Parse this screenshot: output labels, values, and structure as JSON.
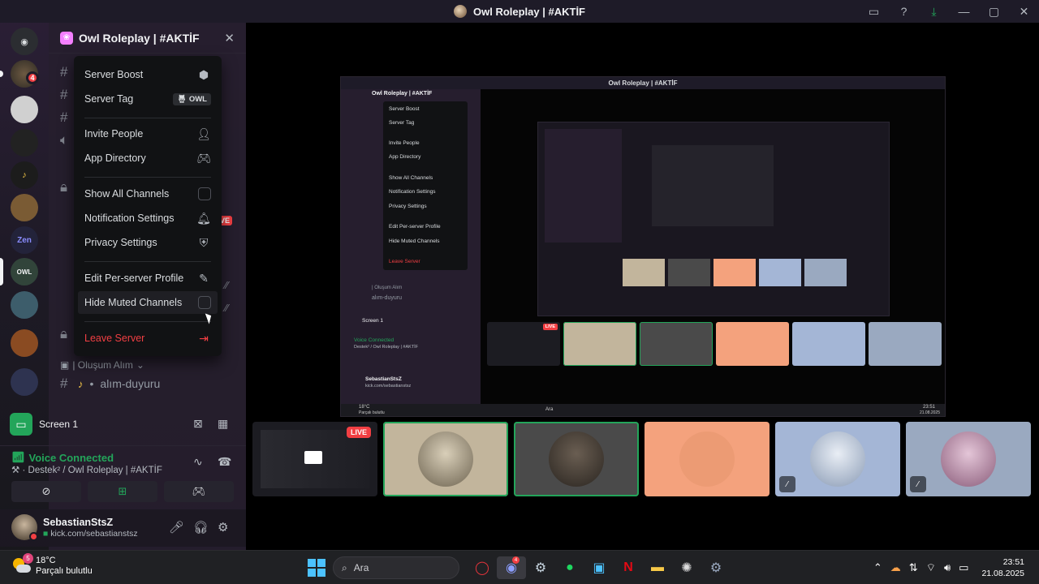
{
  "window": {
    "title": "Owl Roleplay | #AKTİF"
  },
  "server": {
    "name": "Owl Roleplay | #AKTİF"
  },
  "rail": {
    "home_badge": "4"
  },
  "channels": {
    "category": "| Oluşum Alım",
    "channel_name": "alım-duyuru",
    "live_badge": "VE"
  },
  "menu": {
    "items": [
      {
        "label": "Server Boost",
        "icon": "boost-icon"
      },
      {
        "label": "Server Tag",
        "icon": "tag-pill",
        "tag": "OWL"
      },
      {
        "label": "Invite People",
        "icon": "add-user-icon"
      },
      {
        "label": "App Directory",
        "icon": "controller-icon"
      },
      {
        "label": "Show All Channels",
        "icon": "checkbox"
      },
      {
        "label": "Notification Settings",
        "icon": "bell-icon"
      },
      {
        "label": "Privacy Settings",
        "icon": "shield-icon"
      },
      {
        "label": "Edit Per-server Profile",
        "icon": "pencil-icon"
      },
      {
        "label": "Hide Muted Channels",
        "icon": "checkbox"
      },
      {
        "label": "Leave Server",
        "icon": "leave-icon"
      }
    ]
  },
  "stream": {
    "label": "Screen 1"
  },
  "voice": {
    "status": "Voice Connected",
    "location": "Destek² / Owl Roleplay | #AKTİF"
  },
  "user": {
    "name": "SebastianStsZ",
    "subtitle": "kick.com/sebastianstsz"
  },
  "tiles": [
    {
      "kind": "screen",
      "live": "LIVE",
      "bg": "#1c1c22"
    },
    {
      "kind": "avatar",
      "bg": "#c2b59c",
      "speaking": true
    },
    {
      "kind": "avatar",
      "bg": "#4a4a4a",
      "speaking": true
    },
    {
      "kind": "avatar",
      "bg": "#f4a27d",
      "speaking": false
    },
    {
      "kind": "avatar",
      "bg": "#a4b6d6",
      "speaking": false,
      "muted": true
    },
    {
      "kind": "avatar",
      "bg": "#9aa9c0",
      "speaking": false,
      "muted": true
    }
  ],
  "inner": {
    "title": "Owl Roleplay | #AKTİF",
    "menu": [
      "Server Boost",
      "Server Tag",
      "Invite People",
      "App Directory",
      "Show All Channels",
      "Notification Settings",
      "Privacy Settings",
      "Edit Per-server Profile",
      "Hide Muted Channels",
      "Leave Server"
    ],
    "screen": "Screen 1",
    "voice": "Voice Connected",
    "voice_sub": "Destek² / Owl Roleplay | #AKTİF",
    "user": "SebastianStsZ",
    "user_sub": "kick.com/sebastianstsz",
    "live": "LIVE",
    "search": "Ara",
    "weather_temp": "18°C",
    "weather_text": "Parçalı bulutlu",
    "clock_time": "23:51",
    "clock_date": "21.08.2025",
    "category": "| Oluşum Alım",
    "channel": "alım-duyuru"
  },
  "taskbar": {
    "weather_temp": "18°C",
    "weather_text": "Parçalı bulutlu",
    "weather_badge": "5",
    "search_placeholder": "Ara",
    "discord_badge": "4",
    "time": "23:51",
    "date": "21.08.2025"
  },
  "colors": {
    "accent_green": "#23a55a",
    "danger": "#f23f43",
    "menu_bg": "#111214"
  }
}
